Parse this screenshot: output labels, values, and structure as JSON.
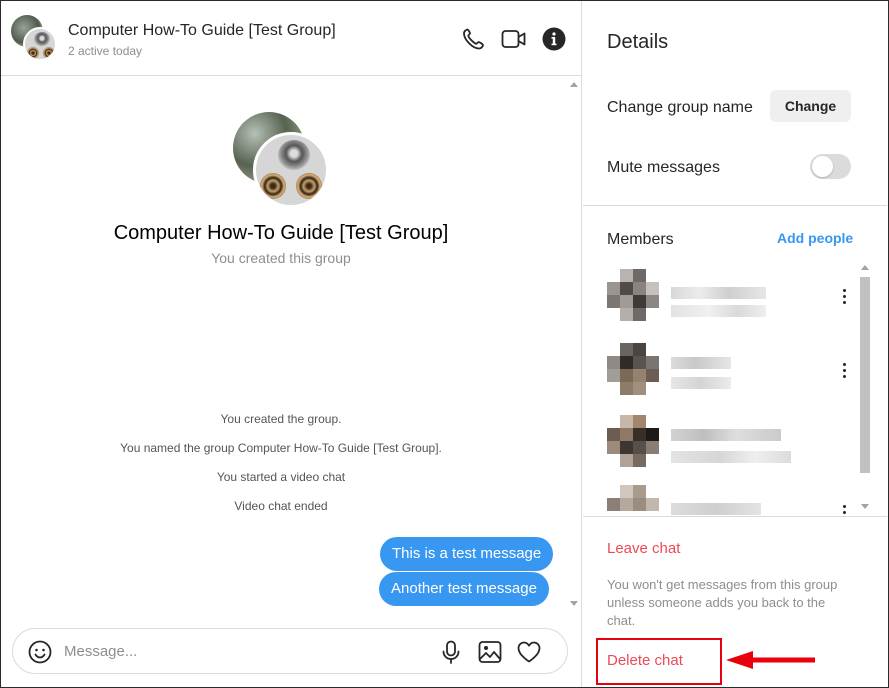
{
  "colors": {
    "accent": "#3897f0",
    "danger": "#ed4956",
    "annotation": "#e8000d",
    "border": "#dbdbdb"
  },
  "chat": {
    "header": {
      "title": "Computer How-To Guide [Test Group]",
      "subtitle": "2 active today",
      "icons": [
        "phone-icon",
        "video-camera-icon",
        "info-icon"
      ]
    },
    "group": {
      "title": "Computer How-To Guide [Test Group]",
      "subtitle": "You created this group"
    },
    "system_messages": [
      "You created the group.",
      "You named the group Computer How-To Guide [Test Group].",
      "You started a video chat",
      "Video chat ended"
    ],
    "messages": [
      {
        "text": "This is a test message",
        "from": "me"
      },
      {
        "text": "Another test message",
        "from": "me"
      }
    ],
    "composer": {
      "placeholder": "Message...",
      "icons": [
        "emoji-icon",
        "microphone-icon",
        "image-icon",
        "heart-icon"
      ]
    }
  },
  "details": {
    "title": "Details",
    "change_group_name_label": "Change group name",
    "change_button": "Change",
    "mute_label": "Mute messages",
    "mute_enabled": false,
    "members_label": "Members",
    "add_people": "Add people",
    "leave_chat": "Leave chat",
    "leave_note": "You won't get messages from this group unless someone adds you back to the chat.",
    "delete_chat": "Delete chat"
  }
}
